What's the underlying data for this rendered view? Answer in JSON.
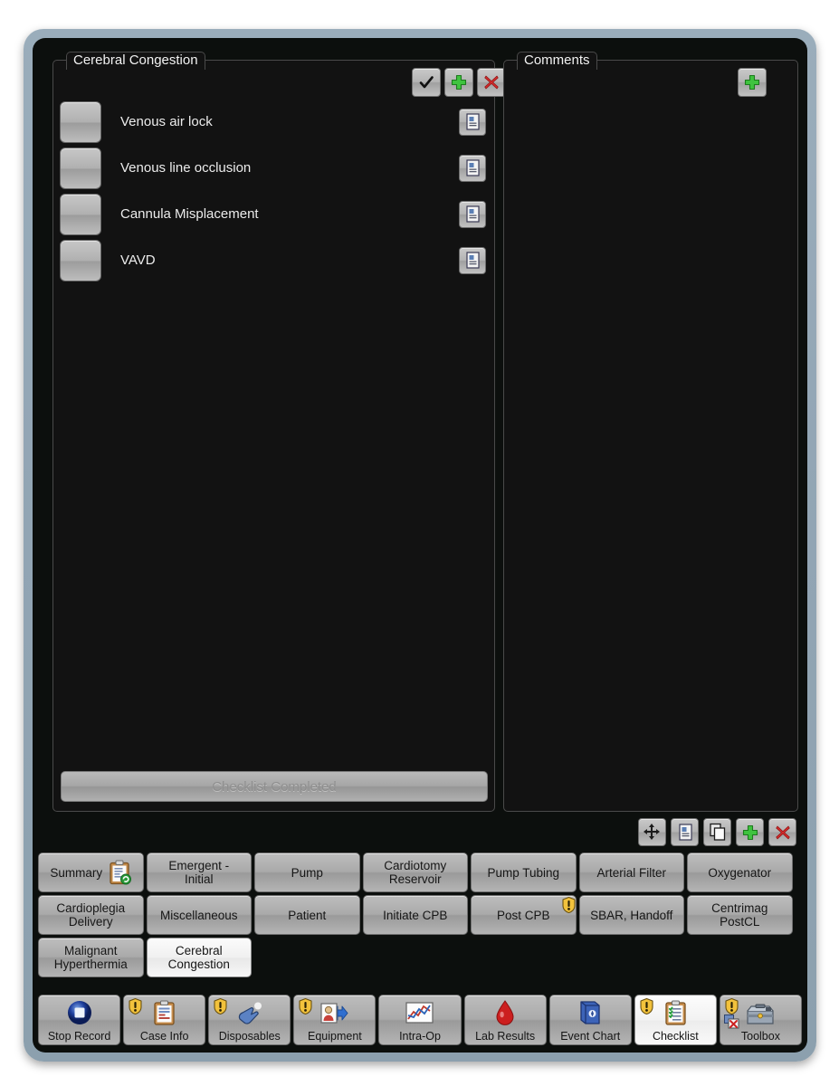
{
  "theme": {
    "bezel_color": "#93a6b5",
    "screen_bg": "#0c0f0d",
    "panel_bg": "#121212",
    "panel_border": "#4a4a4a",
    "text_light": "#ececec",
    "accent_green": "#3fc33f",
    "accent_red": "#d12b2b",
    "warn_yellow": "#f2c23c"
  },
  "checklist_panel": {
    "legend": "Cerebral Congestion",
    "header_buttons": [
      {
        "name": "mark-complete-button",
        "icon": "check-icon",
        "label": "Mark Complete"
      },
      {
        "name": "add-item-button",
        "icon": "plus-icon",
        "label": "Add Item"
      },
      {
        "name": "delete-item-button",
        "icon": "close-icon",
        "label": "Delete Item"
      }
    ],
    "items": [
      {
        "label": "Venous air lock",
        "checked": false,
        "note_icon": "note-icon"
      },
      {
        "label": "Venous line occlusion",
        "checked": false,
        "note_icon": "note-icon"
      },
      {
        "label": "Cannula Misplacement",
        "checked": false,
        "note_icon": "note-icon"
      },
      {
        "label": "VAVD",
        "checked": false,
        "note_icon": "note-icon"
      }
    ],
    "completed_button": {
      "label": "Checklist Completed",
      "enabled": false
    }
  },
  "comments_panel": {
    "legend": "Comments",
    "add_button": {
      "name": "add-comment-button",
      "icon": "plus-icon",
      "label": "Add Comment"
    },
    "entries": []
  },
  "mid_toolbar": {
    "buttons": [
      {
        "name": "move-button",
        "icon": "move-arrows-icon",
        "label": "Move"
      },
      {
        "name": "note-button",
        "icon": "note-icon",
        "label": "Note"
      },
      {
        "name": "copy-button",
        "icon": "copy-icon",
        "label": "Copy"
      },
      {
        "name": "add-button",
        "icon": "plus-icon",
        "label": "Add"
      },
      {
        "name": "delete-button",
        "icon": "close-icon",
        "label": "Delete"
      }
    ]
  },
  "tabs": [
    {
      "label": "Summary",
      "icon": "clipboard-sync-icon",
      "active": false,
      "warn": false
    },
    {
      "label": "Emergent -\nInitial",
      "icon": null,
      "active": false,
      "warn": false
    },
    {
      "label": "Pump",
      "icon": null,
      "active": false,
      "warn": false
    },
    {
      "label": "Cardiotomy\nReservoir",
      "icon": null,
      "active": false,
      "warn": false
    },
    {
      "label": "Pump Tubing",
      "icon": null,
      "active": false,
      "warn": false
    },
    {
      "label": "Arterial Filter",
      "icon": null,
      "active": false,
      "warn": false
    },
    {
      "label": "Oxygenator",
      "icon": null,
      "active": false,
      "warn": false
    },
    {
      "label": "Cardioplegia\nDelivery",
      "icon": null,
      "active": false,
      "warn": false
    },
    {
      "label": "Miscellaneous",
      "icon": null,
      "active": false,
      "warn": false
    },
    {
      "label": "Patient",
      "icon": null,
      "active": false,
      "warn": false
    },
    {
      "label": "Initiate CPB",
      "icon": null,
      "active": false,
      "warn": false
    },
    {
      "label": "Post CPB",
      "icon": null,
      "active": false,
      "warn": true
    },
    {
      "label": "SBAR, Handoff",
      "icon": null,
      "active": false,
      "warn": false
    },
    {
      "label": "Centrimag\nPostCL",
      "icon": null,
      "active": false,
      "warn": false
    },
    {
      "label": "Malignant\nHyperthermia",
      "icon": null,
      "active": false,
      "warn": false
    },
    {
      "label": "Cerebral\nCongestion",
      "icon": null,
      "active": true,
      "warn": false
    }
  ],
  "bottom_nav": [
    {
      "label": "Stop Record",
      "icon": "stop-record-icon",
      "active": false,
      "warn": false,
      "subbadge": false
    },
    {
      "label": "Case Info",
      "icon": "case-info-clipboard-icon",
      "active": false,
      "warn": true,
      "subbadge": false
    },
    {
      "label": "Disposables",
      "icon": "gloved-hand-icon",
      "active": false,
      "warn": true,
      "subbadge": false
    },
    {
      "label": "Equipment",
      "icon": "equipment-person-icon",
      "active": false,
      "warn": true,
      "subbadge": false
    },
    {
      "label": "Intra-Op",
      "icon": "line-chart-icon",
      "active": false,
      "warn": false,
      "subbadge": false
    },
    {
      "label": "Lab Results",
      "icon": "blood-drop-icon",
      "active": false,
      "warn": false,
      "subbadge": false
    },
    {
      "label": "Event Chart",
      "icon": "blue-book-icon",
      "active": false,
      "warn": false,
      "subbadge": false
    },
    {
      "label": "Checklist",
      "icon": "checklist-clipboard-icon",
      "active": true,
      "warn": true,
      "subbadge": false
    },
    {
      "label": "Toolbox",
      "icon": "toolbox-icon",
      "active": false,
      "warn": true,
      "subbadge": true
    }
  ]
}
